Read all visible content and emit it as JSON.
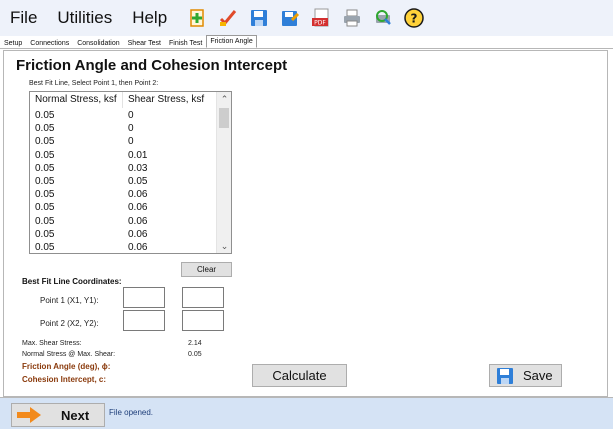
{
  "menu": {
    "file": "File",
    "utilities": "Utilities",
    "help": "Help"
  },
  "toolbar_icons": [
    "new-document-icon",
    "edit-icon",
    "save-icon",
    "save-as-icon",
    "pdf-icon",
    "print-icon",
    "print-preview-icon",
    "help-icon"
  ],
  "tabs": [
    "Setup",
    "Connections",
    "Consolidation",
    "Shear Test",
    "Finish Test",
    "Friction Angle"
  ],
  "active_tab": "Friction Angle",
  "page": {
    "heading": "Friction Angle and Cohesion Intercept",
    "subtext": "Best Fit Line, Select Point 1, then Point 2:"
  },
  "table": {
    "columns": [
      "Normal Stress, ksf",
      "Shear Stress, ksf"
    ],
    "rows": [
      [
        "0.05",
        "0"
      ],
      [
        "0.05",
        "0"
      ],
      [
        "0.05",
        "0"
      ],
      [
        "0.05",
        "0.01"
      ],
      [
        "0.05",
        "0.03"
      ],
      [
        "0.05",
        "0.05"
      ],
      [
        "0.05",
        "0.06"
      ],
      [
        "0.05",
        "0.06"
      ],
      [
        "0.05",
        "0.06"
      ],
      [
        "0.05",
        "0.06"
      ],
      [
        "0.05",
        "0.06"
      ]
    ]
  },
  "clear_label": "Clear",
  "best_fit": {
    "title": "Best Fit Line Coordinates:",
    "point1_label": "Point 1 (X1, Y1):",
    "point2_label": "Point 2 (X2, Y2):",
    "point1": [
      "",
      ""
    ],
    "point2": [
      "",
      ""
    ]
  },
  "results": {
    "max_shear_label": "Max. Shear Stress:",
    "max_shear_value": "2.14",
    "normal_at_max_label": "Normal Stress @ Max. Shear:",
    "normal_at_max_value": "0.05",
    "friction_angle_label": "Friction Angle (deg), ϕ:",
    "cohesion_label": "Cohesion Intercept, c:"
  },
  "calculate_label": "Calculate",
  "save_label": "Save",
  "next_label": "Next",
  "status_text": "File opened.",
  "colors": {
    "accent_brown": "#8a3a0c",
    "status_blue": "#1f3f7a",
    "bottom_bar": "#d5e3f5"
  }
}
